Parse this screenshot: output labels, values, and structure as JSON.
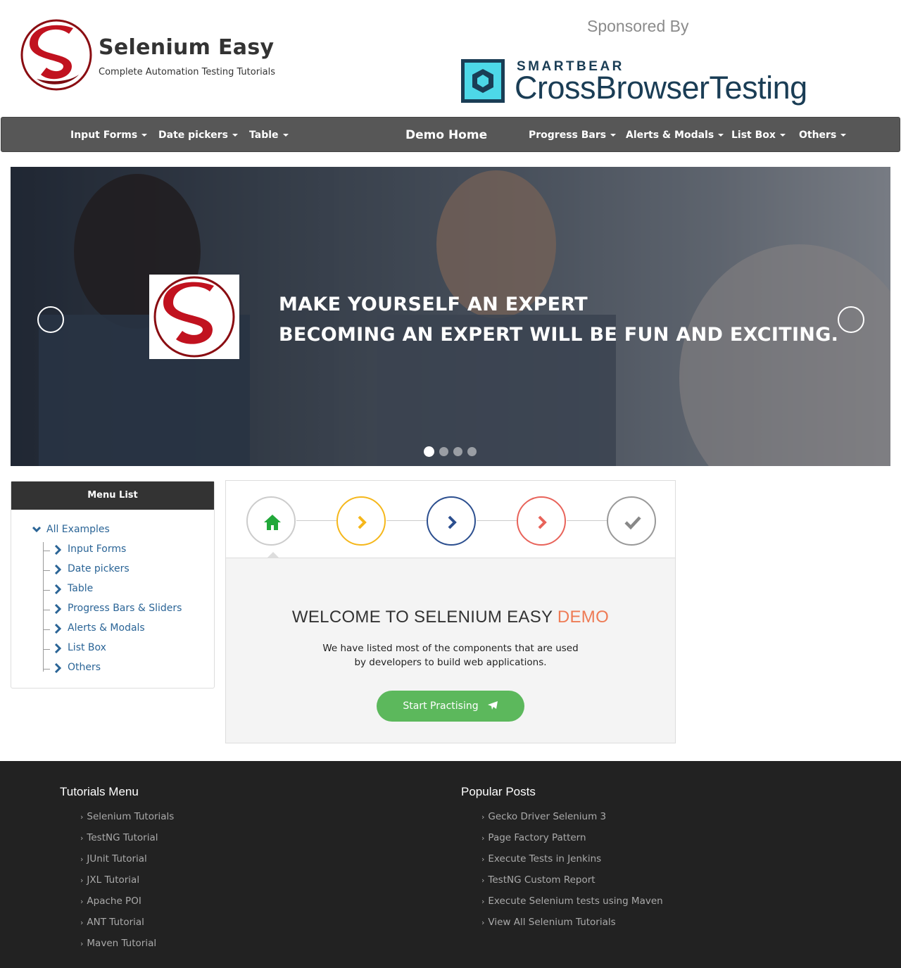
{
  "header": {
    "site_title": "Selenium Easy",
    "tagline": "Complete Automation Testing Tutorials",
    "sponsored_label": "Sponsored By",
    "sponsor_brand": "SMARTBEAR",
    "sponsor_product": "CrossBrowserTesting",
    "colors": {
      "logo_red": "#c1121f",
      "sponsor_navy": "#1a3d55",
      "sponsor_cyan": "#4dd8e8"
    }
  },
  "navbar": {
    "brand": "Demo Home",
    "left_items": [
      "Input Forms",
      "Date pickers",
      "Table"
    ],
    "right_items": [
      "Progress Bars",
      "Alerts & Modals",
      "List Box",
      "Others"
    ],
    "bg_color": "#575757"
  },
  "carousel": {
    "caption_line_1": "MAKE YOURSELF AN EXPERT",
    "caption_line_2": "BECOMING AN EXPERT WILL BE FUN AND EXCITING.",
    "slide_count": 4,
    "active_slide": 1
  },
  "sidebar": {
    "heading": "Menu List",
    "root": "All Examples",
    "items": [
      "Input Forms",
      "Date pickers",
      "Table",
      "Progress Bars & Sliders",
      "Alerts & Modals",
      "List Box",
      "Others"
    ],
    "link_color": "#2a6496"
  },
  "wizard": {
    "steps": [
      {
        "icon": "home-icon",
        "color": "#ccc",
        "icon_color": "#22a83a"
      },
      {
        "icon": "chevron-right-icon",
        "color": "#f5b71b",
        "icon_color": "#f5b71b"
      },
      {
        "icon": "chevron-right-icon",
        "color": "#2c4f8f",
        "icon_color": "#2c4f8f"
      },
      {
        "icon": "chevron-right-icon",
        "color": "#e8635a",
        "icon_color": "#e8635a"
      },
      {
        "icon": "check-icon",
        "color": "#999",
        "icon_color": "#888"
      }
    ],
    "title_main": "WELCOME TO SELENIUM EASY ",
    "title_accent": "DEMO",
    "accent_color": "#ee7b55",
    "text_line_1": "We have listed most of the components that are used",
    "text_line_2": "by developers to build web applications.",
    "button_label": "Start Practising",
    "button_color": "#5cb85c"
  },
  "footer": {
    "tutorials_heading": "Tutorials Menu",
    "tutorials": [
      "Selenium Tutorials",
      "TestNG Tutorial",
      "JUnit Tutorial",
      "JXL Tutorial",
      "Apache POI",
      "ANT Tutorial",
      "Maven Tutorial"
    ],
    "posts_heading": "Popular Posts",
    "posts": [
      "Gecko Driver Selenium 3",
      "Page Factory Pattern",
      "Execute Tests in Jenkins",
      "TestNG Custom Report",
      "Execute Selenium tests using Maven",
      "View All Selenium Tutorials"
    ],
    "bg_color": "#222222"
  }
}
